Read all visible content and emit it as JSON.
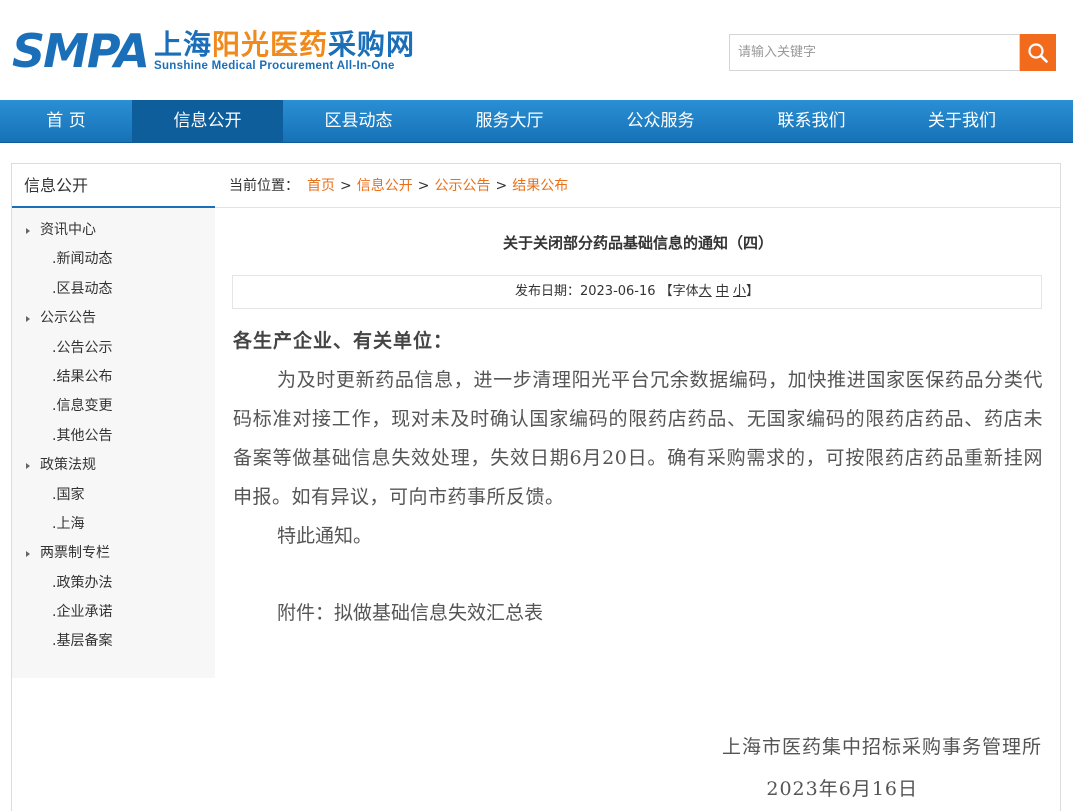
{
  "header": {
    "logo_abbr": "SMPA",
    "logo_cn_part1": "上海",
    "logo_cn_part2": "阳光",
    "logo_cn_part3": "医药",
    "logo_cn_part4": "采购网",
    "logo_en": "Sunshine Medical Procurement All-In-One",
    "search_placeholder": "请输入关键字",
    "brand_blue": "#1a6fb8",
    "brand_orange": "#f08a1c"
  },
  "nav": {
    "items": [
      "首 页",
      "信息公开",
      "区县动态",
      "服务大厅",
      "公众服务",
      "联系我们",
      "关于我们"
    ],
    "active": "信息公开"
  },
  "sidebar": {
    "title": "信息公开",
    "sections": [
      {
        "label": "资讯中心",
        "children": [
          ".新闻动态",
          ".区县动态"
        ]
      },
      {
        "label": "公示公告",
        "children": [
          ".公告公示",
          ".结果公布",
          ".信息变更",
          ".其他公告"
        ]
      },
      {
        "label": "政策法规",
        "children": [
          ".国家",
          ".上海"
        ]
      },
      {
        "label": "两票制专栏",
        "children": [
          ".政策办法",
          ".企业承诺",
          ".基层备案"
        ]
      }
    ]
  },
  "breadcrumb": {
    "prefix": "当前位置：",
    "items": [
      "首页",
      "信息公开",
      "公示公告",
      "结果公布"
    ],
    "separator": ">"
  },
  "article": {
    "title": "关于关闭部分药品基础信息的通知（四）",
    "meta_prefix": "发布日期：2023-06-16 【字体",
    "font_large": "大",
    "font_medium": "中",
    "font_small": "小",
    "meta_suffix": "】",
    "greeting": "各生产企业、有关单位：",
    "paragraph": "为及时更新药品信息，进一步清理阳光平台冗余数据编码，加快推进国家医保药品分类代码标准对接工作，现对未及时确认国家编码的限药店药品、无国家编码的限药店药品、药店未备案等做基础信息失效处理，失效日期6月20日。确有采购需求的，可按限药店药品重新挂网申报。如有异议，可向市药事所反馈。",
    "notice": "特此通知。",
    "attachment": "附件：拟做基础信息失效汇总表",
    "signature_org": "上海市医药集中招标采购事务管理所",
    "signature_date": "2023年6月16日"
  }
}
